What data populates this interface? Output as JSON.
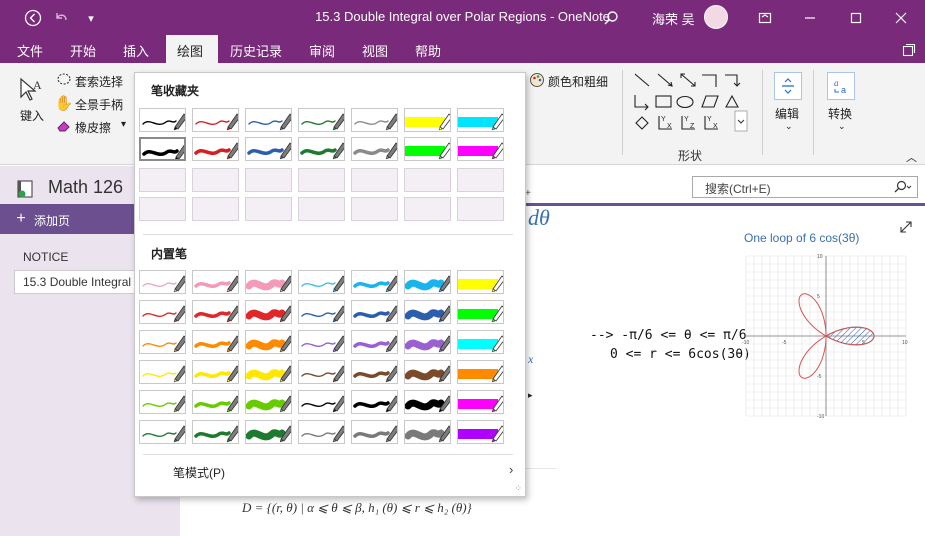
{
  "window": {
    "title": "15.3 Double Integral over Polar Regions  -  OneNote",
    "user_name": "海荣 吴"
  },
  "menu": {
    "items": [
      "文件",
      "开始",
      "插入",
      "绘图",
      "历史记录",
      "审阅",
      "视图",
      "帮助"
    ],
    "active_index": 3
  },
  "ribbon": {
    "type_label": "键入",
    "lasso_label": "套索选择",
    "panning_label": "全景手柄",
    "eraser_label": "橡皮擦",
    "color_thickness_label": "颜色和粗细",
    "shapes_group_label": "形状",
    "edit_label": "编辑",
    "convert_label": "转换"
  },
  "left_pane": {
    "notebook_title": "Math 126",
    "add_page_label": "添加页",
    "section_label": "NOTICE",
    "page_item": "15.3 Double Integral over Polar Regions"
  },
  "search": {
    "placeholder": "搜索(Ctrl+E)"
  },
  "page": {
    "note_line1": "--> -π/6 <= θ <= π/6",
    "note_line2": "0 <= r <= 6cos(3θ)",
    "graph_title": "One loop of 6 cos(3θ)",
    "formula": "D = {(r, θ) | α ⩽ θ ⩽ β, h₁ (θ) ⩽ r ⩽ h₂ (θ)}",
    "dtheta": "dθ"
  },
  "pen_gallery": {
    "favorites_title": "笔收藏夹",
    "builtin_title": "内置笔",
    "pen_mode_label": "笔模式(P)",
    "favorites": [
      [
        "#000000",
        "#d62020",
        "#2b5fae",
        "#1e7a2e",
        "#8a8a8a",
        "#ffff00",
        "#00e5ff"
      ],
      [
        "#000000",
        "#d62020",
        "#2b5fae",
        "#1e7a2e",
        "#8a8a8a",
        "#00ff00",
        "#ff00ff"
      ]
    ],
    "builtin": [
      [
        "#f3a6c0",
        "#f39ab8",
        "#f39ab8",
        "#3ec0e8",
        "#18b4ee",
        "#18b4ee",
        "#ffff00"
      ],
      [
        "#e02828",
        "#e02828",
        "#e02828",
        "#2b5fae",
        "#2b5fae",
        "#2b5fae",
        "#00ff00"
      ],
      [
        "#ff8a00",
        "#ff8a00",
        "#ff8a00",
        "#9a5fd0",
        "#9a5fd0",
        "#9a5fd0",
        "#00ffff"
      ],
      [
        "#ffe800",
        "#ffe800",
        "#ffe800",
        "#7a4a2a",
        "#7a4a2a",
        "#7a4a2a",
        "#ff8a00"
      ],
      [
        "#66cc00",
        "#66cc00",
        "#66cc00",
        "#000000",
        "#000000",
        "#000000",
        "#ff00ff"
      ],
      [
        "#1e7a2e",
        "#1e7a2e",
        "#1e7a2e",
        "#7a7a7a",
        "#7a7a7a",
        "#7a7a7a",
        "#b000ff"
      ]
    ]
  },
  "colors": {
    "accent": "#7a2a7a",
    "section_purple": "#6b4f8f",
    "ink_blue": "#3a6fb0"
  }
}
